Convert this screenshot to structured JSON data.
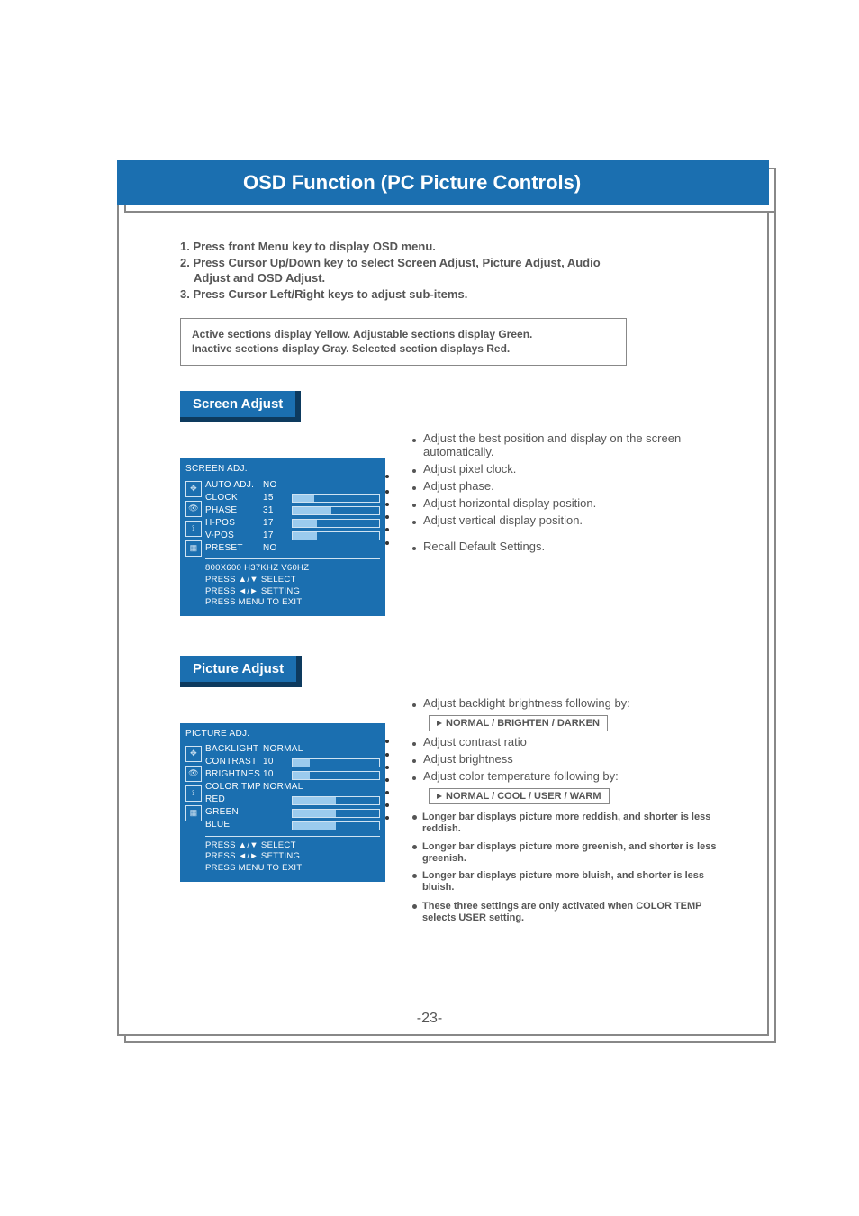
{
  "title": "OSD Function (PC Picture Controls)",
  "instructions": {
    "step1": "1. Press front Menu key to display OSD menu.",
    "step2": "2. Press Cursor Up/Down key to select Screen  Adjust, Picture Adjust, Audio",
    "step2b": "Adjust and OSD Adjust.",
    "step3": "3. Press Cursor Left/Right keys to adjust sub-items."
  },
  "legend": {
    "line1": "Active sections display Yellow.  Adjustable sections display Green.",
    "line2": "Inactive sections display Gray.  Selected section displays Red."
  },
  "screen_adjust": {
    "tag": "Screen Adjust",
    "osd_title": "SCREEN ADJ.",
    "items": [
      {
        "label": "AUTO ADJ.",
        "value": "NO",
        "bar": null
      },
      {
        "label": "CLOCK",
        "value": "15",
        "bar": 25
      },
      {
        "label": "PHASE",
        "value": "31",
        "bar": 45
      },
      {
        "label": "H-POS",
        "value": "17",
        "bar": 28
      },
      {
        "label": "V-POS",
        "value": "17",
        "bar": 28
      },
      {
        "label": "PRESET",
        "value": "NO",
        "bar": null
      }
    ],
    "status": "800X600    H37KHZ    V60HZ",
    "help1": "PRESS  ▲/▼   SELECT",
    "help2": "PRESS  ◄/►   SETTING",
    "help3": "PRESS MENU TO EXIT",
    "callouts": [
      "Adjust  the best position and display on the screen automatically.",
      "Adjust pixel clock.",
      "Adjust phase.",
      "Adjust horizontal display position.",
      "Adjust vertical display position.",
      "Recall Default Settings."
    ]
  },
  "picture_adjust": {
    "tag": "Picture Adjust",
    "osd_title": "PICTURE ADJ.",
    "items": [
      {
        "label": "BACKLIGHT",
        "value": "NORMAL",
        "bar": null
      },
      {
        "label": "CONTRAST",
        "value": "10",
        "bar": 20
      },
      {
        "label": "BRIGHTNES",
        "value": "10",
        "bar": 20
      },
      {
        "label": "COLOR TMP",
        "value": "NORMAL",
        "bar": null
      },
      {
        "label": "RED",
        "value": "",
        "bar": 50
      },
      {
        "label": "GREEN",
        "value": "",
        "bar": 50
      },
      {
        "label": "BLUE",
        "value": "",
        "bar": 50
      }
    ],
    "help1": "PRESS  ▲/▼   SELECT",
    "help2": "PRESS  ◄/►   SETTING",
    "help3": "PRESS MENU TO EXIT",
    "callouts": {
      "c1": "Adjust backlight brightness  following by:",
      "c1_box": "NORMAL / BRIGHTEN / DARKEN",
      "c2": "Adjust contrast ratio",
      "c3": "Adjust  brightness",
      "c4": "Adjust color temperature following by:",
      "c4_box": "NORMAL / COOL / USER / WARM",
      "b1": "Longer bar displays picture more reddish, and shorter is less reddish.",
      "b2": "Longer bar displays picture more greenish, and shorter is less greenish.",
      "b3": "Longer bar displays picture more bluish, and shorter is less bluish.",
      "note": "These three settings are only activated  when COLOR TEMP selects USER setting."
    }
  },
  "page_number": "-23-",
  "icons": {
    "move": "✥",
    "eye": "👁",
    "slider": "⟟",
    "window": "▦",
    "brightness": "☼",
    "rgb": "◍"
  }
}
